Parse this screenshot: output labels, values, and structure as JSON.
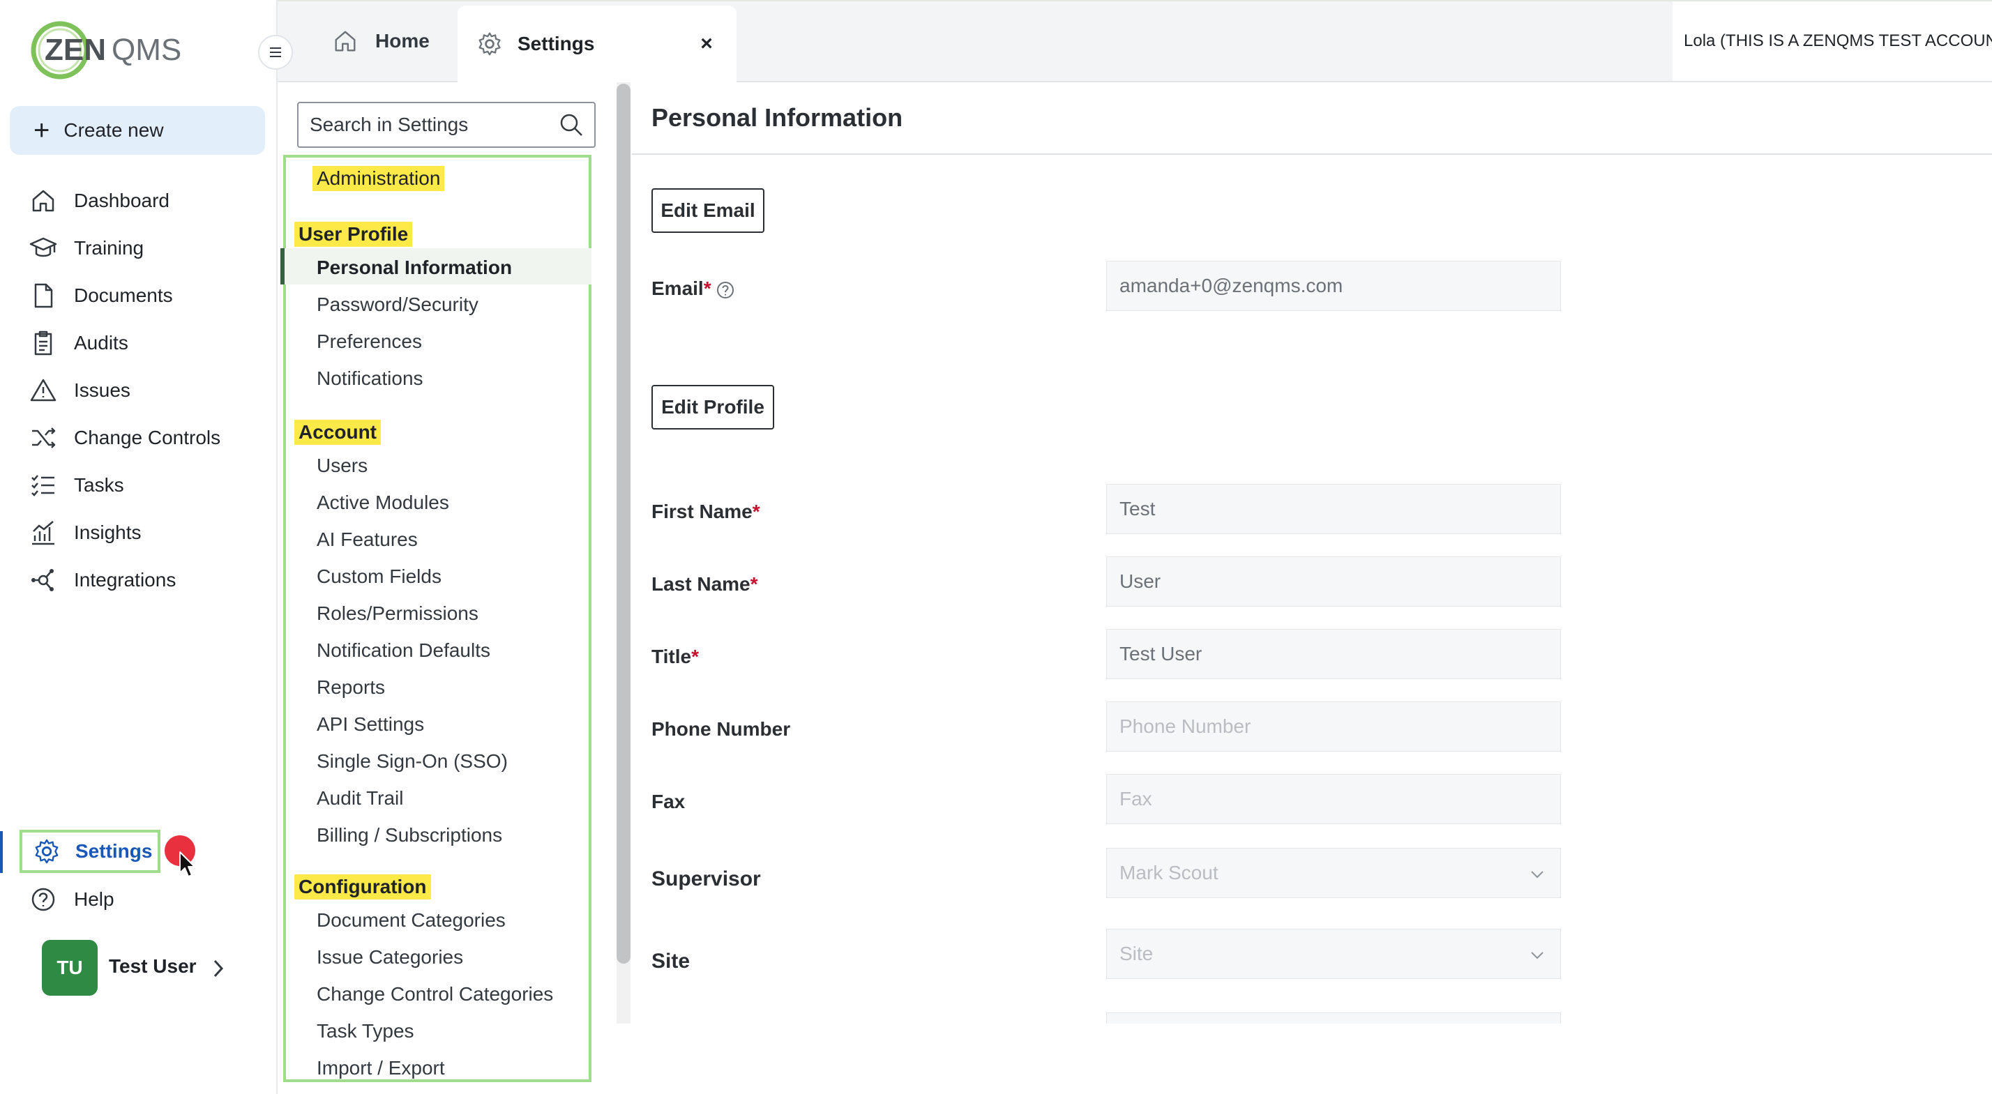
{
  "brand": {
    "logo_text_zen": "ZEN",
    "logo_text_qms": "QMS"
  },
  "sidebar": {
    "create_new_label": "Create new",
    "items": [
      {
        "label": "Dashboard",
        "icon": "home-icon"
      },
      {
        "label": "Training",
        "icon": "graduation-cap-icon"
      },
      {
        "label": "Documents",
        "icon": "document-icon"
      },
      {
        "label": "Audits",
        "icon": "clipboard-icon"
      },
      {
        "label": "Issues",
        "icon": "warning-triangle-icon"
      },
      {
        "label": "Change Controls",
        "icon": "shuffle-icon"
      },
      {
        "label": "Tasks",
        "icon": "checklist-icon"
      },
      {
        "label": "Insights",
        "icon": "chart-icon"
      },
      {
        "label": "Integrations",
        "icon": "network-icon"
      }
    ],
    "settings_label": "Settings",
    "help_label": "Help",
    "user": {
      "initials": "TU",
      "name": "Test User"
    }
  },
  "tabs": [
    {
      "label": "Home",
      "icon": "home-icon"
    },
    {
      "label": "Settings",
      "icon": "gear-icon",
      "active": true,
      "close": "×"
    }
  ],
  "account_label": "Lola (THIS IS A ZENQMS TEST ACCOUNT",
  "settings_nav": {
    "search_placeholder": "Search in Settings",
    "administration": "Administration",
    "sections": [
      {
        "title": "User Profile",
        "items": [
          "Personal Information",
          "Password/Security",
          "Preferences",
          "Notifications"
        ]
      },
      {
        "title": "Account",
        "items": [
          "Users",
          "Active Modules",
          "AI Features",
          "Custom Fields",
          "Roles/Permissions",
          "Notification Defaults",
          "Reports",
          "API Settings",
          "Single Sign-On (SSO)",
          "Audit Trail",
          "Billing / Subscriptions"
        ]
      },
      {
        "title": "Configuration",
        "items": [
          "Document Categories",
          "Issue Categories",
          "Change Control Categories",
          "Task Types",
          "Import / Export"
        ]
      }
    ],
    "active_item": "Personal Information"
  },
  "main": {
    "title": "Personal Information",
    "edit_email_label": "Edit Email",
    "edit_profile_label": "Edit Profile",
    "email": {
      "label": "Email",
      "required": "*",
      "value": "amanda+0@zenqms.com"
    },
    "fields": [
      {
        "label": "First Name",
        "required": "*",
        "value": "Test"
      },
      {
        "label": "Last Name",
        "required": "*",
        "value": "User"
      },
      {
        "label": "Title",
        "required": "*",
        "value": "Test User"
      },
      {
        "label": "Phone Number",
        "required": "",
        "placeholder": "Phone Number"
      },
      {
        "label": "Fax",
        "required": "",
        "placeholder": "Fax"
      },
      {
        "label": "Supervisor",
        "required": "",
        "value": "Mark Scout",
        "type": "select"
      },
      {
        "label": "Site",
        "required": "",
        "placeholder": "Site",
        "type": "select"
      }
    ]
  },
  "colors": {
    "accent": "#1958b8",
    "highlight": "#fde947",
    "outline_green": "#9fdc8c",
    "avatar": "#2f8a43",
    "required": "#c8102e"
  }
}
